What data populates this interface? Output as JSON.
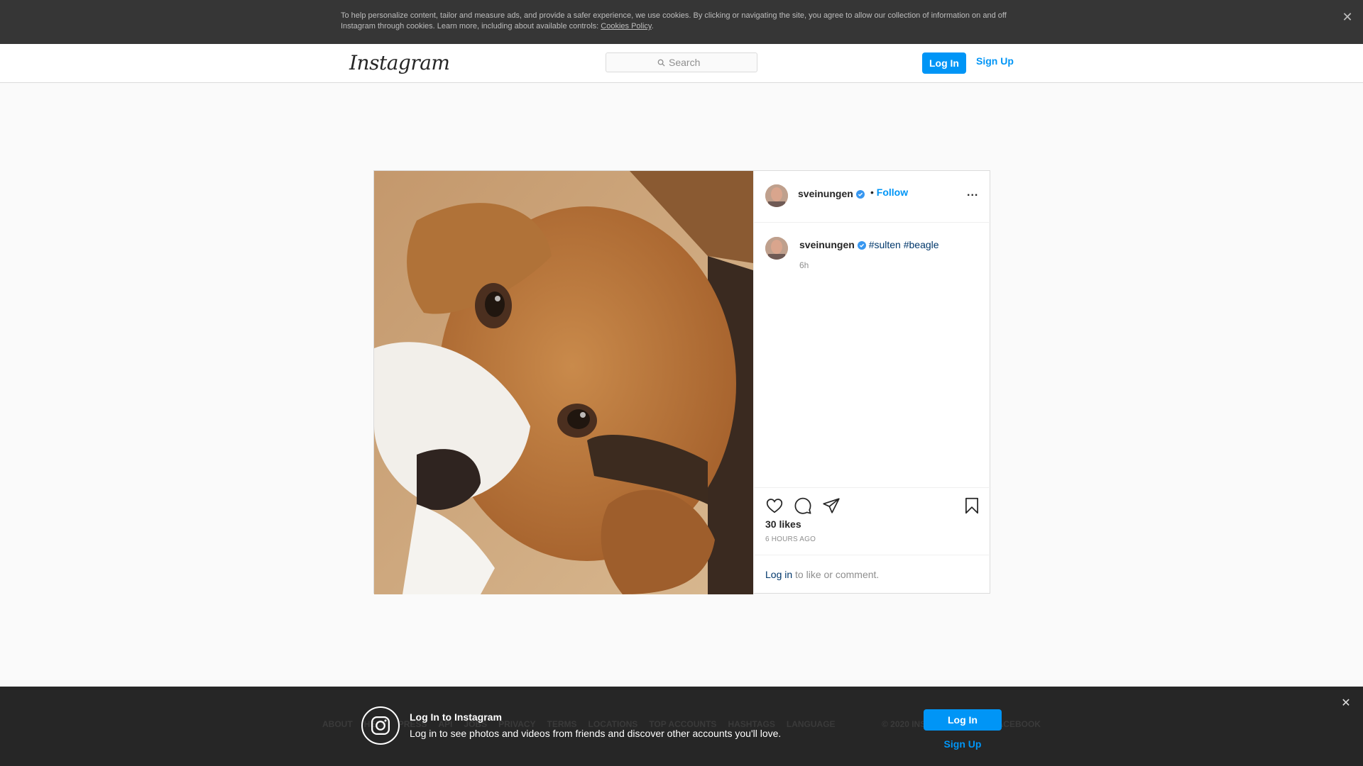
{
  "cookie_banner": {
    "text": "To help personalize content, tailor and measure ads, and provide a safer experience, we use cookies. By clicking or navigating the site, you agree to allow our collection of information on and off Instagram through cookies. Learn more, including about available controls: ",
    "policy_link": "Cookies Policy",
    "suffix": ".",
    "close_glyph": "✕"
  },
  "header": {
    "logo": "Instagram",
    "search_placeholder": "Search",
    "login_label": "Log In",
    "signup_label": "Sign Up"
  },
  "post": {
    "image_subject": "beagle-photo",
    "author": "sveinungen",
    "verified": true,
    "follow_separator": "•",
    "follow_label": "Follow",
    "more_glyph": "...",
    "caption": {
      "user": "sveinungen",
      "hashtags": [
        "#sulten",
        "#beagle"
      ],
      "age": "6h"
    },
    "likes": "30 likes",
    "posted": "6 HOURS AGO",
    "login_prompt_link": "Log in",
    "login_prompt_rest": " to like or comment."
  },
  "footer": {
    "links": [
      "ABOUT",
      "HELP",
      "PRESS",
      "API",
      "JOBS",
      "PRIVACY",
      "TERMS",
      "LOCATIONS",
      "TOP ACCOUNTS",
      "HASHTAGS",
      "LANGUAGE"
    ],
    "copyright": "© 2020 INSTAGRAM FROM FACEBOOK",
    "close_glyph": "✕"
  },
  "login_overlay": {
    "title": "Log In to Instagram",
    "subtitle": "Log in to see photos and videos from friends and discover other accounts you'll love.",
    "login_label": "Log In",
    "signup_label": "Sign Up"
  },
  "colors": {
    "accent": "#0095f6",
    "link_dark": "#00376b",
    "cookie_bg": "#363636",
    "overlay_bg": "#262626"
  }
}
